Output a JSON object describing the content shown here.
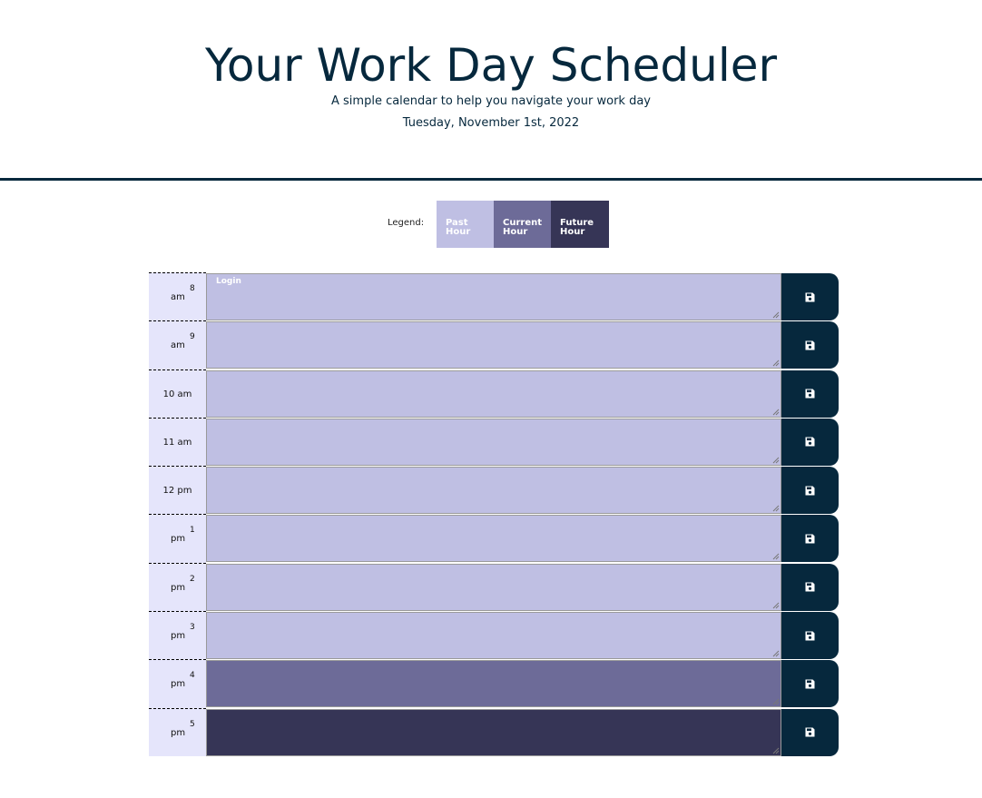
{
  "header": {
    "title": "Your Work Day Scheduler",
    "subtitle": "A simple calendar to help you navigate your work day",
    "date": "Tuesday, November 1st, 2022"
  },
  "legend": {
    "label": "Legend:",
    "items": [
      {
        "line1": "Past",
        "line2": "Hour",
        "color": "#BFBFE3"
      },
      {
        "line1": "Current",
        "line2": "Hour",
        "color": "#6D6B98"
      },
      {
        "line1": "Future",
        "line2": "Hour",
        "color": "#363556"
      }
    ]
  },
  "colors": {
    "brand": "#06283D",
    "hour_bg": "#E5E5FB",
    "past": "#BFBFE3",
    "present": "#6D6B98",
    "future": "#363556"
  },
  "icons": {
    "save": "floppy-disk-icon"
  },
  "rows": [
    {
      "hour_num": "8",
      "hour_suffix": "am",
      "hour_label": "",
      "layout": "split",
      "state": "past",
      "text": "Login"
    },
    {
      "hour_num": "9",
      "hour_suffix": "am",
      "hour_label": "",
      "layout": "split",
      "state": "past",
      "text": ""
    },
    {
      "hour_num": "",
      "hour_suffix": "",
      "hour_label": "10 am",
      "layout": "single",
      "state": "past",
      "text": ""
    },
    {
      "hour_num": "",
      "hour_suffix": "",
      "hour_label": "11 am",
      "layout": "single",
      "state": "past",
      "text": ""
    },
    {
      "hour_num": "",
      "hour_suffix": "",
      "hour_label": "12 pm",
      "layout": "single",
      "state": "past",
      "text": ""
    },
    {
      "hour_num": "1",
      "hour_suffix": "pm",
      "hour_label": "",
      "layout": "split",
      "state": "past",
      "text": ""
    },
    {
      "hour_num": "2",
      "hour_suffix": "pm",
      "hour_label": "",
      "layout": "split",
      "state": "past",
      "text": ""
    },
    {
      "hour_num": "3",
      "hour_suffix": "pm",
      "hour_label": "",
      "layout": "split",
      "state": "past",
      "text": ""
    },
    {
      "hour_num": "4",
      "hour_suffix": "pm",
      "hour_label": "",
      "layout": "split",
      "state": "present",
      "text": ""
    },
    {
      "hour_num": "5",
      "hour_suffix": "pm",
      "hour_label": "",
      "layout": "split",
      "state": "future",
      "text": ""
    }
  ]
}
